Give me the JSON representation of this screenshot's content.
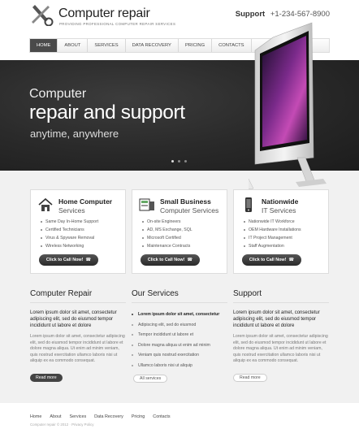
{
  "header": {
    "title": "Computer repair",
    "tagline": "Providing professional computer repair services",
    "support_label": "Support",
    "support_phone": "+1-234-567-8900"
  },
  "nav": [
    "Home",
    "About",
    "Services",
    "Data Recovery",
    "Pricing",
    "Contacts"
  ],
  "hero": {
    "line1": "Computer",
    "line2": "repair and support",
    "line3": "anytime, anywhere",
    "slides": 3,
    "active_slide": 1
  },
  "cards": [
    {
      "title": "Home Computer",
      "subtitle": "Services",
      "icon": "house-icon",
      "items": [
        "Same Day In-Home Support",
        "Certified Technicians",
        "Virus & Spyware Removal",
        "Wireless Networking"
      ],
      "button": "Click to Call Now!"
    },
    {
      "title": "Small Business",
      "subtitle": "Computer Services",
      "icon": "server-icon",
      "items": [
        "On-site Engineers",
        "AD, MS Exchange, SQL",
        "Microsoft Certified",
        "Maintenance Contracts"
      ],
      "button": "Click to Call Now!"
    },
    {
      "title": "Nationwide",
      "subtitle": "IT Services",
      "icon": "phone-icon",
      "items": [
        "Nationwide IT Workforce",
        "OEM Hardware Installations",
        "IT Project Management",
        "Staff Augmentation"
      ],
      "button": "Click to Call Now!"
    }
  ],
  "columns": {
    "repair": {
      "title": "Computer Repair",
      "lead": "Lorem ipsum dolor sit amet, consectetur adipiscing elit, sed do eiusmod tempor incididunt ut labore et dolore",
      "body": "Lorem ipsum dolor sit amet, consectetur adipiscing elit, sed do eiusmod tempor incididunt ut labore et dolore magna aliqua. Ut enim ad minim veniam, quis nostrud exercitation ullamco laboris nisi ut aliquip ex ea commodo consequat.",
      "button": "Read more"
    },
    "services": {
      "title": "Our Services",
      "items": [
        "Lorem ipsum dolor sit amet, consectetur",
        "Adipiscing elit, sed do eiusmod",
        "Tempor incididunt ut labore et",
        "Dolore magna aliqua ut enim ad minim",
        "Veniam quis nostrud exercitation",
        "Ullamco laboris nisi ut aliquip"
      ],
      "button": "All services"
    },
    "support": {
      "title": "Support",
      "lead": "Lorem ipsum dolor sit amet, consectetur adipiscing elit, sed do eiusmod tempor incididunt ut labore et dolore",
      "body": "Lorem ipsum dolor sit amet, consectetur adipiscing elit, sed do eiusmod tempor incididunt ut labore et dolore magna aliqua. Ut enim ad minim veniam, quis nostrud exercitation ullamco laboris nisi ut aliquip ex ea commodo consequat.",
      "button": "Read more"
    }
  },
  "footer": {
    "links": [
      "Home",
      "About",
      "Services",
      "Data Recovery",
      "Pricing",
      "Contacts"
    ],
    "copyright": "Computer repair © 2012 · Privacy Policy"
  }
}
